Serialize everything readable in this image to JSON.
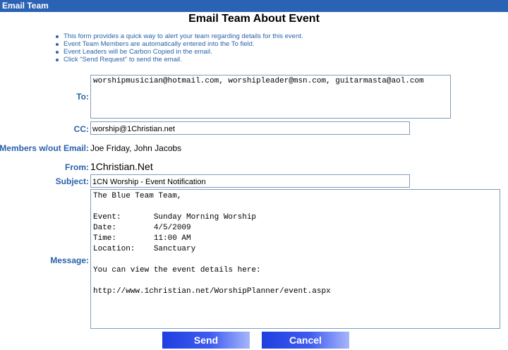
{
  "window": {
    "title": "Email Team"
  },
  "page": {
    "heading": "Email Team About Event"
  },
  "notes": [
    "This form provides a quick way to alert your team regarding details for this event.",
    "Event Team Members are automatically entered into the To field.",
    "Event Leaders will be Carbon Copied in the email.",
    "Click \"Send Request\" to send the email."
  ],
  "form": {
    "to_label": "To:",
    "to_value": "worshipmusician@hotmail.com, worshipleader@msn.com, guitarmasta@aol.com",
    "cc_label": "CC:",
    "cc_value": "worship@1Christian.net",
    "members_label": "Members w/out Email:",
    "members_value": "Joe Friday, John Jacobs",
    "from_label": "From:",
    "from_value": "1Christian.Net",
    "subject_label": "Subject:",
    "subject_value": "1CN Worship - Event Notification",
    "message_label": "Message:",
    "message_value": "The Blue Team Team,\n\nEvent:       Sunday Morning Worship\nDate:        4/5/2009\nTime:        11:00 AM\nLocation:    Sanctuary\n\nYou can view the event details here:\n\nhttp://www.1christian.net/WorshipPlanner/event.aspx"
  },
  "buttons": {
    "send": "Send",
    "cancel": "Cancel"
  }
}
